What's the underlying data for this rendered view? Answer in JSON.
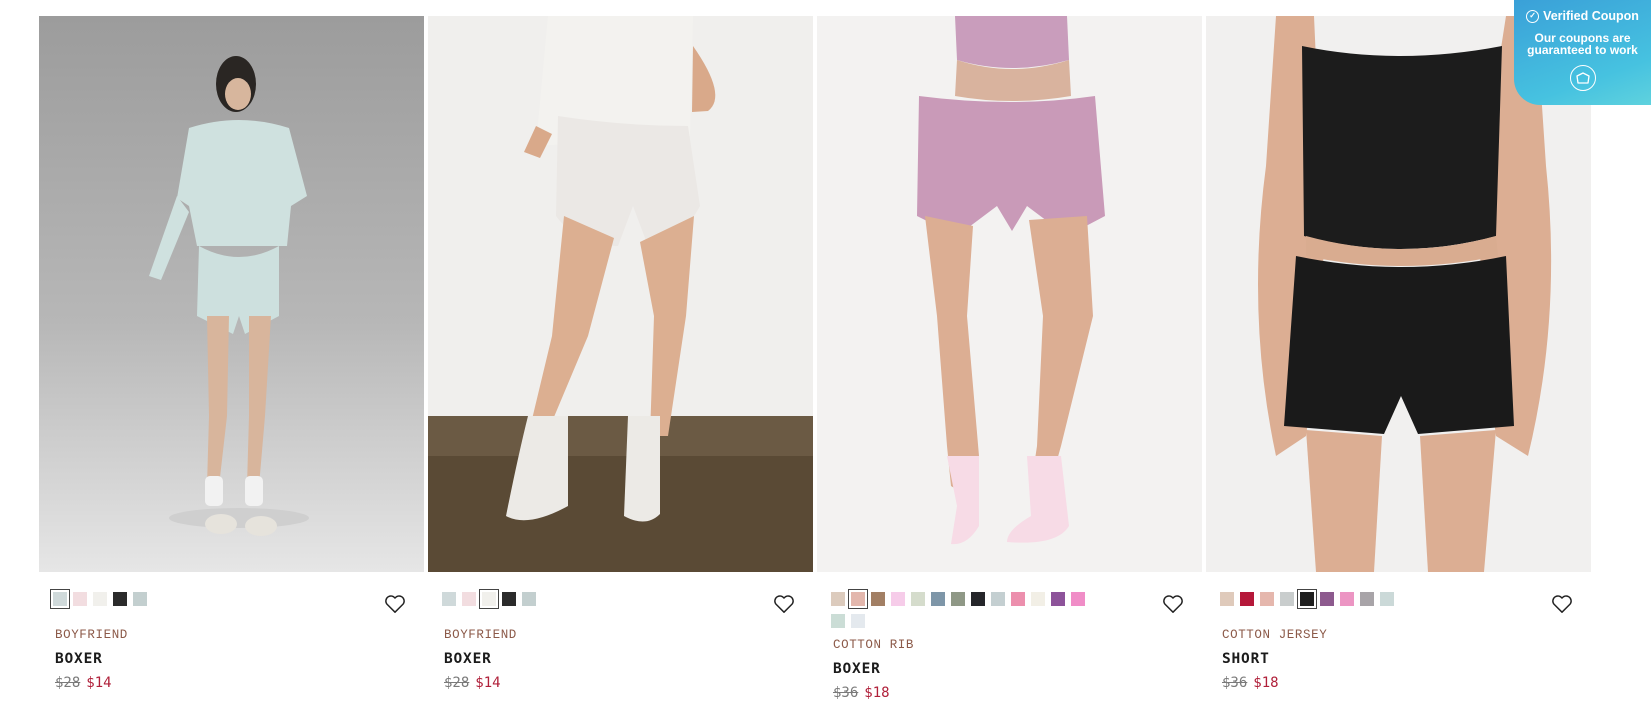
{
  "products": [
    {
      "collection": "BOYFRIEND",
      "name": "BOXER",
      "old_price": "$28",
      "price": "$14",
      "swatches": [
        "#cfd9da",
        "#f2dde0",
        "#f1f0ec",
        "#2b2b2b",
        "#c3cfcf"
      ],
      "selected": 0
    },
    {
      "collection": "BOYFRIEND",
      "name": "BOXER",
      "old_price": "$28",
      "price": "$14",
      "swatches": [
        "#cfd9da",
        "#f2dde0",
        "#f1f0ec",
        "#2b2b2b",
        "#c3cfcf"
      ],
      "selected": 2
    },
    {
      "collection": "COTTON RIB",
      "name": "BOXER",
      "old_price": "$36",
      "price": "$18",
      "swatches": [
        "#dccbbd",
        "#e3b7ad",
        "#a27f64",
        "#f6cce9",
        "#d5dccc",
        "#7e96a8",
        "#8f9886",
        "#25262a",
        "#c4cfd1",
        "#ec8fad",
        "#f2efe6",
        "#8d539a",
        "#f08dc7",
        "#cbddd6",
        "#e4e9ee"
      ],
      "selected": 1
    },
    {
      "collection": "COTTON JERSEY",
      "name": "SHORT",
      "old_price": "$36",
      "price": "$18",
      "swatches": [
        "#dfcabb",
        "#b5183a",
        "#e5b7ad",
        "#c9cdcd",
        "#202020",
        "#8d5a8e",
        "#ec95c3",
        "#a8a4a8",
        "#cbd9d8"
      ],
      "selected": 4
    }
  ],
  "coupon": {
    "title": "Verified Coupon",
    "line1": "Our coupons are",
    "line2": "guaranteed to work"
  },
  "icons": {
    "wishlist": "heart-icon",
    "coupon_badge": "check-circle-icon",
    "coupon_action": "coupon-icon"
  }
}
